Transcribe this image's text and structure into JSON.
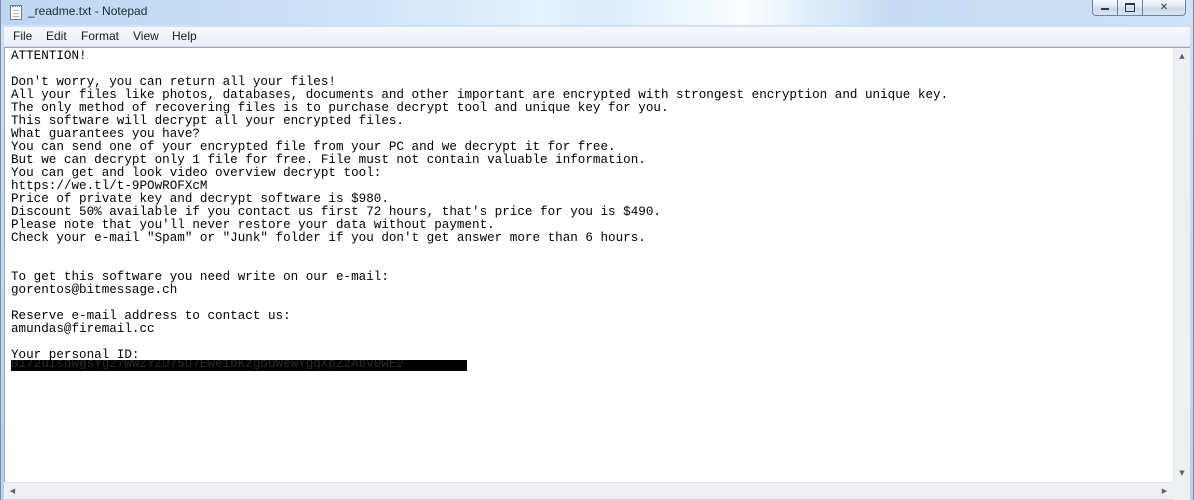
{
  "window": {
    "title": "_readme.txt - Notepad",
    "icon": "notepad-icon",
    "controls": {
      "minimize_icon": "minimize-icon",
      "maximize_icon": "maximize-icon",
      "close_glyph": "✕"
    }
  },
  "menu": {
    "file": "File",
    "edit": "Edit",
    "format": "Format",
    "view": "View",
    "help": "Help"
  },
  "document": {
    "text": "ATTENTION!\n\nDon't worry, you can return all your files!\nAll your files like photos, databases, documents and other important are encrypted with strongest encryption and unique key.\nThe only method of recovering files is to purchase decrypt tool and unique key for you.\nThis software will decrypt all your encrypted files.\nWhat guarantees you have?\nYou can send one of your encrypted file from your PC and we decrypt it for free.\nBut we can decrypt only 1 file for free. File must not contain valuable information.\nYou can get and look video overview decrypt tool:\nhttps://we.tl/t-9POwROFXcM\nPrice of private key and decrypt software is $980.\nDiscount 50% available if you contact us first 72 hours, that's price for you is $490.\nPlease note that you'll never restore your data without payment.\nCheck your e-mail \"Spam\" or \"Junk\" folder if you don't get answer more than 6 hours.\n\n\nTo get this software you need write on our e-mail:\ngorentos@bitmessage.ch\n\nReserve e-mail address to contact us:\namundas@firemail.cc\n\nYour personal ID:",
    "redacted_id": "0172uIsdwgsYg27WwZYZU75U7Ewe1bKzgbuWeWYgqXpZzAbv0wE2"
  },
  "scrollbars": {
    "up_arrow": "▲",
    "down_arrow": "▼",
    "left_arrow": "◀",
    "right_arrow": "▶"
  }
}
